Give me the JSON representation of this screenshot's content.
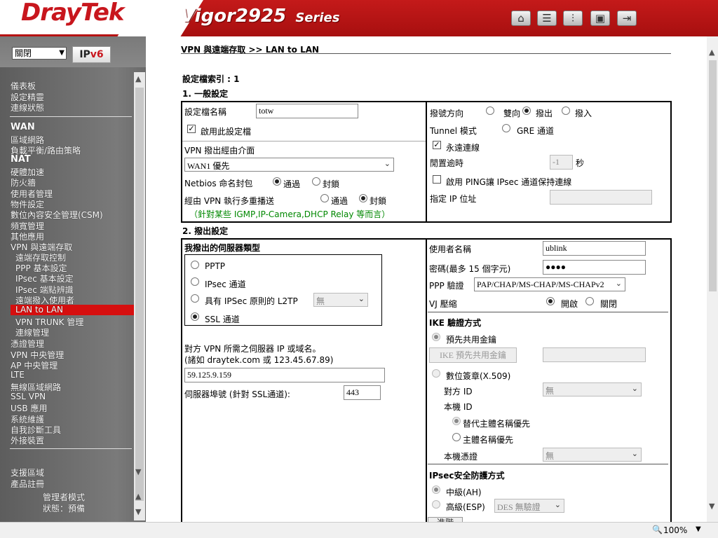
{
  "header": {
    "logo": "DrayTek",
    "model": "Vigor2925",
    "series": "Series"
  },
  "sidebar": {
    "lang": "關閉",
    "ipv6": "IPv6",
    "items": [
      {
        "label": "儀表板"
      },
      {
        "label": "設定精靈"
      },
      {
        "label": "連線狀態"
      },
      {
        "label": "WAN"
      },
      {
        "label": "區域網路"
      },
      {
        "label": "負載平衡/路由策略"
      },
      {
        "label": "NAT"
      },
      {
        "label": "硬體加速"
      },
      {
        "label": "防火牆"
      },
      {
        "label": "使用者管理"
      },
      {
        "label": "物件設定"
      },
      {
        "label": "數位內容安全管理(CSM)"
      },
      {
        "label": "頻寬管理"
      },
      {
        "label": "其他應用"
      },
      {
        "label": "VPN 與遠端存取"
      },
      {
        "label": "遠端存取控制"
      },
      {
        "label": "PPP 基本設定"
      },
      {
        "label": "IPsec 基本設定"
      },
      {
        "label": "IPsec 端點辨識"
      },
      {
        "label": "遠端撥入使用者"
      },
      {
        "label": "LAN to LAN"
      },
      {
        "label": "VPN TRUNK 管理"
      },
      {
        "label": "連線管理"
      },
      {
        "label": "憑證管理"
      },
      {
        "label": "VPN 中央管理"
      },
      {
        "label": "AP 中央管理"
      },
      {
        "label": "LTE"
      },
      {
        "label": "無線區域網路"
      },
      {
        "label": "SSL VPN"
      },
      {
        "label": "USB 應用"
      },
      {
        "label": "系統維護"
      },
      {
        "label": "自我診斷工具"
      },
      {
        "label": "外接裝置"
      },
      {
        "label": "支援區域"
      },
      {
        "label": "產品註冊"
      }
    ],
    "mode": "管理者模式",
    "status": "狀態：預備"
  },
  "main": {
    "breadcrumb": "VPN 與遠端存取 >> LAN to LAN",
    "profile_index": "設定檔索引 : 1",
    "general": {
      "title": "1. 一般設定",
      "name_label": "設定檔名稱",
      "name_value": "totw",
      "enable_label": "啟用此設定檔",
      "via_label": "VPN 撥出經由介面",
      "via_value": "WAN1 優先",
      "netbios_label": "Netbios 命名封包",
      "pass": "通過",
      "block": "封鎖",
      "multicast_label": "經由 VPN 執行多重播送",
      "note": "（針對某些 IGMP,IP-Camera,DHCP Relay 等而言）",
      "dir_label": "撥號方向",
      "both": "雙向",
      "out": "撥出",
      "in": "撥入",
      "tunnel_label": "Tunnel 模式",
      "gre": "GRE 通道",
      "always_on": "永遠連線",
      "idle_label": "閒置逾時",
      "idle_value": "-1",
      "sec": "秒",
      "ping_label": "啟用 PING讓 IPsec 通道保持連線",
      "ip_label": "指定 IP 位址"
    },
    "dialout": {
      "title": "2. 撥出設定",
      "server_type": "我撥出的伺服器類型",
      "pptp": "PPTP",
      "ipsec": "IPsec 通道",
      "l2tp": "具有 IPSec 原則的 L2TP",
      "l2tp_sel": "無",
      "ssl": "SSL 通道",
      "remote_label1": "對方 VPN 所需之伺服器 IP 或域名。",
      "remote_label2": "(諸如 draytek.com 或 123.45.67.89)",
      "remote_value": "59.125.9.159",
      "port_label": "伺服器埠號 (針對 SSL通道):",
      "port_value": "443",
      "user_label": "使用者名稱",
      "user_value": "ublink",
      "pwd_label": "密碼(最多 15 個字元)",
      "pwd_value": "●●●●",
      "ppp_auth_label": "PPP 驗證",
      "ppp_auth_value": "PAP/CHAP/MS-CHAP/MS-CHAPv2",
      "vj_label": "VJ 壓縮",
      "on": "開啟",
      "off": "關閉",
      "ike_title": "IKE 驗證方式",
      "psk": "預先共用金鑰",
      "psk_btn": "IKE 預先共用金鑰",
      "cert": "數位簽章(X.509)",
      "peer_id": "對方 ID",
      "none": "無",
      "local_id": "本機 ID",
      "alt_subj": "替代主體名稱優先",
      "subj": "主體名稱優先",
      "local_cert": "本機憑證",
      "ipsec_title": "IPsec安全防護方式",
      "ah": "中級(AH)",
      "esp": "高級(ESP)",
      "esp_value": "DES 無驗證",
      "more": "進階"
    }
  },
  "status": {
    "zoom": "100%"
  }
}
